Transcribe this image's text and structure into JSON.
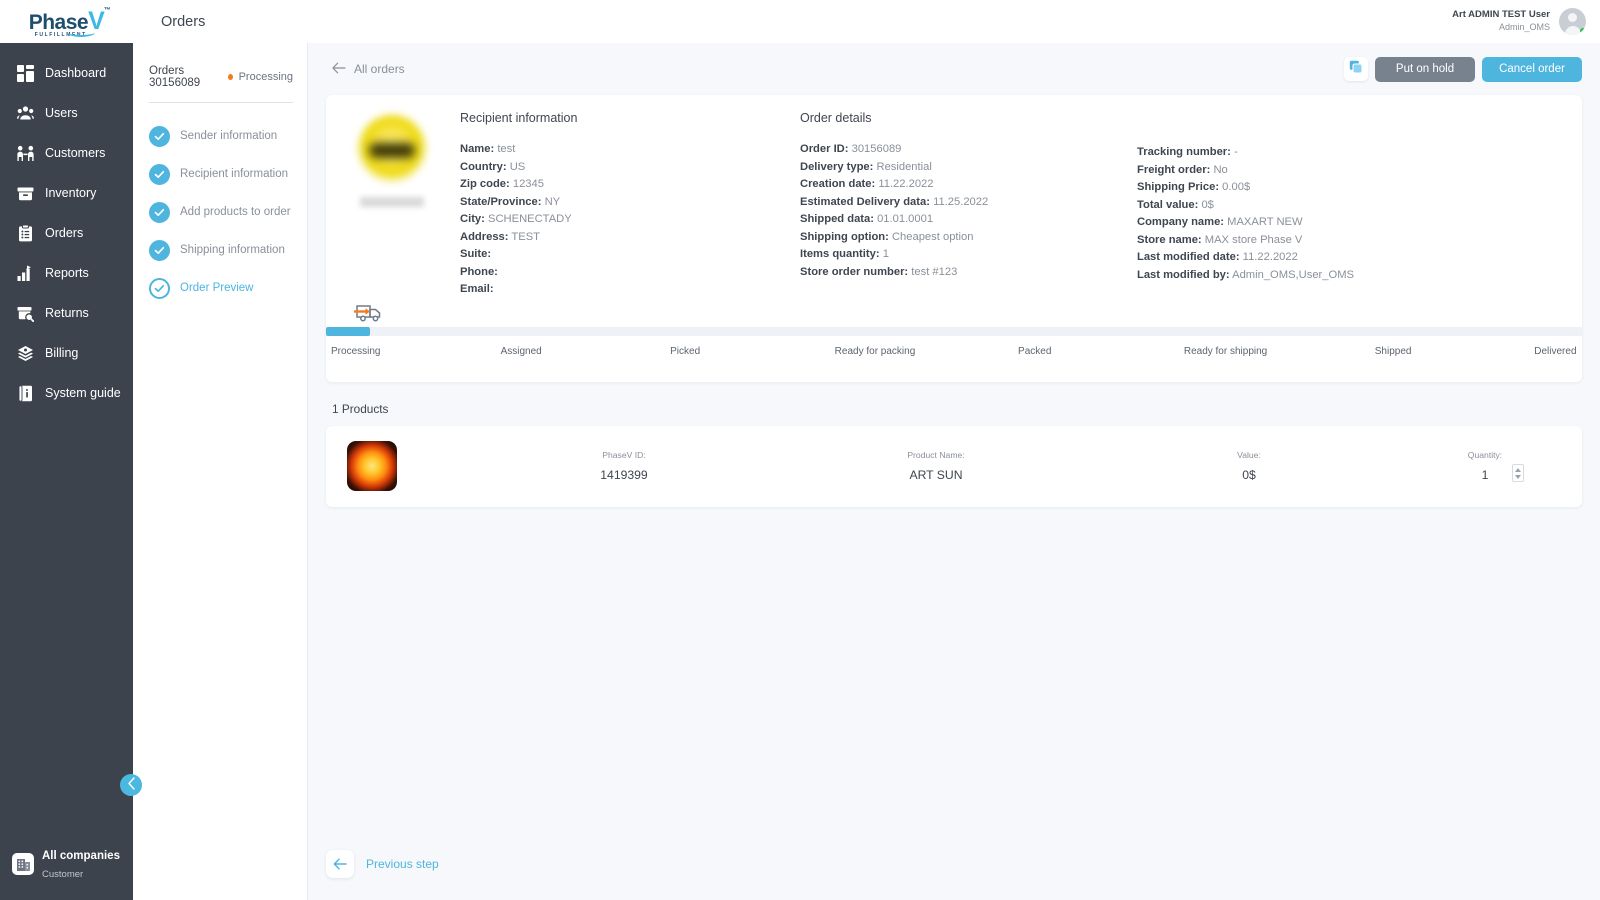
{
  "brand": {
    "logo_main": "Phase",
    "logo_accent": "V",
    "logo_sub": "FULFILLMENT",
    "logo_tm": "™",
    "accent_color": "#4eb5de",
    "sidebar_color": "#3c434d",
    "status_dot_color": "#f07c1e"
  },
  "sidebar": {
    "items": [
      {
        "label": "Dashboard",
        "icon": "dashboard-icon"
      },
      {
        "label": "Users",
        "icon": "users-icon"
      },
      {
        "label": "Customers",
        "icon": "customers-icon"
      },
      {
        "label": "Inventory",
        "icon": "inventory-icon"
      },
      {
        "label": "Orders",
        "icon": "orders-icon"
      },
      {
        "label": "Reports",
        "icon": "reports-icon"
      },
      {
        "label": "Returns",
        "icon": "returns-icon"
      },
      {
        "label": "Billing",
        "icon": "billing-icon"
      },
      {
        "label": "System guide",
        "icon": "system-guide-icon"
      }
    ],
    "company": {
      "name": "All companies",
      "role": "Customer",
      "icon": "building-icon"
    },
    "collapse_icon": "chevron-left-icon"
  },
  "header": {
    "title": "Orders",
    "user_name": "Art ADMIN TEST User",
    "user_role": "Admin_OMS"
  },
  "steps_panel": {
    "order_title": "Orders 30156089",
    "order_status": "Processing",
    "steps": [
      {
        "label": "Sender information",
        "state": "complete"
      },
      {
        "label": "Recipient information",
        "state": "complete"
      },
      {
        "label": "Add products to order",
        "state": "complete"
      },
      {
        "label": "Shipping information",
        "state": "complete"
      },
      {
        "label": "Order Preview",
        "state": "current"
      }
    ]
  },
  "toolbar": {
    "back_label": "All orders",
    "back_icon": "arrow-left-icon",
    "copy_icon": "copy-icon",
    "put_on_hold_label": "Put on hold",
    "cancel_order_label": "Cancel order"
  },
  "recipient": {
    "title": "Recipient information",
    "fields": [
      {
        "label": "Name:",
        "value": "test"
      },
      {
        "label": "Country:",
        "value": "US"
      },
      {
        "label": "Zip code:",
        "value": "12345"
      },
      {
        "label": "State/Province:",
        "value": "NY"
      },
      {
        "label": "City:",
        "value": "SCHENECTADY"
      },
      {
        "label": "Address:",
        "value": "TEST"
      },
      {
        "label": "Suite:",
        "value": ""
      },
      {
        "label": "Phone:",
        "value": ""
      },
      {
        "label": "Email:",
        "value": ""
      }
    ]
  },
  "order_details": {
    "title": "Order details",
    "fields": [
      {
        "label": "Order ID:",
        "value": "30156089"
      },
      {
        "label": "Delivery type:",
        "value": "Residential"
      },
      {
        "label": "Creation date:",
        "value": "11.22.2022"
      },
      {
        "label": "Estimated Delivery data:",
        "value": "11.25.2022"
      },
      {
        "label": "Shipped data:",
        "value": "01.01.0001"
      },
      {
        "label": "Shipping option:",
        "value": "Cheapest option"
      },
      {
        "label": "Items quantity:",
        "value": "1"
      },
      {
        "label": "Store order number:",
        "value": "test #123"
      }
    ]
  },
  "tracking_details": {
    "fields": [
      {
        "label": "Tracking number:",
        "value": "-"
      },
      {
        "label": "Freight order:",
        "value": "No"
      },
      {
        "label": "Shipping Price:",
        "value": "0.00$"
      },
      {
        "label": "Total value:",
        "value": "0$"
      },
      {
        "label": "Company name:",
        "value": "MAXART NEW"
      },
      {
        "label": "Store name:",
        "value": "MAX store Phase V"
      },
      {
        "label": "Last modified date:",
        "value": "11.22.2022"
      },
      {
        "label": "Last modified by:",
        "value": "Admin_OMS,User_OMS"
      }
    ]
  },
  "tracker": {
    "icon": "truck-icon",
    "progress_percent": 3.5,
    "current_stage": "Processing",
    "stages": [
      {
        "label": "Processing",
        "left_pct": 0.4
      },
      {
        "label": "Assigned",
        "left_pct": 13.9
      },
      {
        "label": "Picked",
        "left_pct": 27.4
      },
      {
        "label": "Ready for packing",
        "left_pct": 40.5
      },
      {
        "label": "Packed",
        "left_pct": 55.1
      },
      {
        "label": "Ready for shipping",
        "left_pct": 68.3
      },
      {
        "label": "Shipped",
        "left_pct": 83.5
      },
      {
        "label": "Delivered",
        "left_pct": 96.2
      }
    ]
  },
  "products": {
    "count_label": "1 Products",
    "columns": {
      "phasev_id": "PhaseV ID:",
      "product_name": "Product Name:",
      "value": "Value:",
      "quantity": "Quantity:"
    },
    "rows": [
      {
        "phasev_id": "1419399",
        "product_name": "ART SUN",
        "value": "0$",
        "quantity": "1"
      }
    ]
  },
  "footer": {
    "previous_step_label": "Previous step",
    "previous_step_icon": "arrow-left-icon"
  }
}
